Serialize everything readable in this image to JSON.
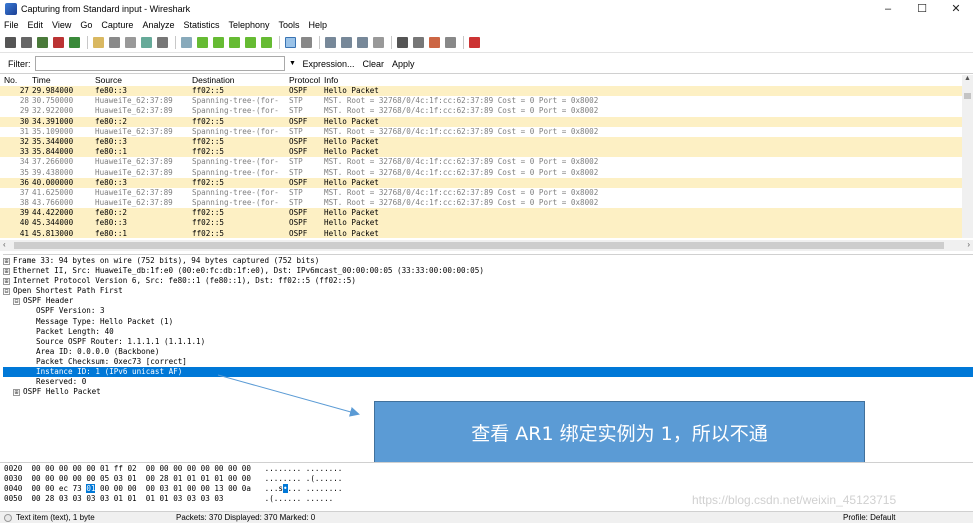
{
  "window": {
    "title": "Capturing from Standard input - Wireshark",
    "minimize": "–",
    "maximize": "☐",
    "close": "✕"
  },
  "menu": [
    "File",
    "Edit",
    "View",
    "Go",
    "Capture",
    "Analyze",
    "Statistics",
    "Telephony",
    "Tools",
    "Help"
  ],
  "filter": {
    "label": "Filter:",
    "value": "",
    "expression": "Expression...",
    "clear": "Clear",
    "apply": "Apply"
  },
  "packet_list": {
    "columns": [
      "No.",
      "Time",
      "Source",
      "Destination",
      "Protocol",
      "Info"
    ],
    "rows": [
      {
        "no": "27",
        "time": "29.984000",
        "src": "fe80::3",
        "dst": "ff02::5",
        "proto": "OSPF",
        "info": "Hello Packet",
        "kind": "ospf"
      },
      {
        "no": "28",
        "time": "30.750000",
        "src": "HuaweiTe_62:37:89",
        "dst": "Spanning-tree-(for-",
        "proto": "STP",
        "info": "MST. Root = 32768/0/4c:1f:cc:62:37:89  Cost = 0  Port = 0x8002",
        "kind": "stp"
      },
      {
        "no": "29",
        "time": "32.922000",
        "src": "HuaweiTe_62:37:89",
        "dst": "Spanning-tree-(for-",
        "proto": "STP",
        "info": "MST. Root = 32768/0/4c:1f:cc:62:37:89  Cost = 0  Port = 0x8002",
        "kind": "stp"
      },
      {
        "no": "30",
        "time": "34.391000",
        "src": "fe80::2",
        "dst": "ff02::5",
        "proto": "OSPF",
        "info": "Hello Packet",
        "kind": "ospf"
      },
      {
        "no": "31",
        "time": "35.109000",
        "src": "HuaweiTe_62:37:89",
        "dst": "Spanning-tree-(for-",
        "proto": "STP",
        "info": "MST. Root = 32768/0/4c:1f:cc:62:37:89  Cost = 0  Port = 0x8002",
        "kind": "stp"
      },
      {
        "no": "32",
        "time": "35.344000",
        "src": "fe80::3",
        "dst": "ff02::5",
        "proto": "OSPF",
        "info": "Hello Packet",
        "kind": "ospf"
      },
      {
        "no": "33",
        "time": "35.844000",
        "src": "fe80::1",
        "dst": "ff02::5",
        "proto": "OSPF",
        "info": "Hello Packet",
        "kind": "ospf"
      },
      {
        "no": "34",
        "time": "37.266000",
        "src": "HuaweiTe_62:37:89",
        "dst": "Spanning-tree-(for-",
        "proto": "STP",
        "info": "MST. Root = 32768/0/4c:1f:cc:62:37:89  Cost = 0  Port = 0x8002",
        "kind": "stp"
      },
      {
        "no": "35",
        "time": "39.438000",
        "src": "HuaweiTe_62:37:89",
        "dst": "Spanning-tree-(for-",
        "proto": "STP",
        "info": "MST. Root = 32768/0/4c:1f:cc:62:37:89  Cost = 0  Port = 0x8002",
        "kind": "stp"
      },
      {
        "no": "36",
        "time": "40.000000",
        "src": "fe80::3",
        "dst": "ff02::5",
        "proto": "OSPF",
        "info": "Hello Packet",
        "kind": "ospf"
      },
      {
        "no": "37",
        "time": "41.625000",
        "src": "HuaweiTe_62:37:89",
        "dst": "Spanning-tree-(for-",
        "proto": "STP",
        "info": "MST. Root = 32768/0/4c:1f:cc:62:37:89  Cost = 0  Port = 0x8002",
        "kind": "stp"
      },
      {
        "no": "38",
        "time": "43.766000",
        "src": "HuaweiTe_62:37:89",
        "dst": "Spanning-tree-(for-",
        "proto": "STP",
        "info": "MST. Root = 32768/0/4c:1f:cc:62:37:89  Cost = 0  Port = 0x8002",
        "kind": "stp"
      },
      {
        "no": "39",
        "time": "44.422000",
        "src": "fe80::2",
        "dst": "ff02::5",
        "proto": "OSPF",
        "info": "Hello Packet",
        "kind": "ospf"
      },
      {
        "no": "40",
        "time": "45.344000",
        "src": "fe80::3",
        "dst": "ff02::5",
        "proto": "OSPF",
        "info": "Hello Packet",
        "kind": "ospf"
      },
      {
        "no": "41",
        "time": "45.813000",
        "src": "fe80::1",
        "dst": "ff02::5",
        "proto": "OSPF",
        "info": "Hello Packet",
        "kind": "ospf"
      }
    ]
  },
  "details": [
    {
      "indent": 0,
      "exp": "⊞",
      "text": "Frame 33: 94 bytes on wire (752 bits), 94 bytes captured (752 bits)"
    },
    {
      "indent": 0,
      "exp": "⊞",
      "text": "Ethernet II, Src: HuaweiTe_db:1f:e0 (00:e0:fc:db:1f:e0), Dst: IPv6mcast_00:00:00:05 (33:33:00:00:00:05)"
    },
    {
      "indent": 0,
      "exp": "⊞",
      "text": "Internet Protocol Version 6, Src: fe80::1 (fe80::1), Dst: ff02::5 (ff02::5)"
    },
    {
      "indent": 0,
      "exp": "⊟",
      "text": "Open Shortest Path First"
    },
    {
      "indent": 1,
      "exp": "⊟",
      "text": "OSPF Header"
    },
    {
      "indent": 2,
      "exp": "",
      "text": "OSPF Version: 3"
    },
    {
      "indent": 2,
      "exp": "",
      "text": "Message Type: Hello Packet (1)"
    },
    {
      "indent": 2,
      "exp": "",
      "text": "Packet Length: 40"
    },
    {
      "indent": 2,
      "exp": "",
      "text": "Source OSPF Router: 1.1.1.1 (1.1.1.1)"
    },
    {
      "indent": 2,
      "exp": "",
      "text": "Area ID: 0.0.0.0 (Backbone)"
    },
    {
      "indent": 2,
      "exp": "",
      "text": "Packet Checksum: 0xec73 [correct]"
    },
    {
      "indent": 2,
      "exp": "",
      "text": "Instance ID: 1 (IPv6 unicast AF)",
      "selected": true
    },
    {
      "indent": 2,
      "exp": "",
      "text": "Reserved: 0"
    },
    {
      "indent": 1,
      "exp": "⊞",
      "text": "OSPF Hello Packet"
    }
  ],
  "bytes": [
    {
      "offset": "0020",
      "hex1": "00 00 00 00 00 01 ff 02",
      "hex2": "00 00 00 00 00 00 00 00",
      "ascii": "........ ........"
    },
    {
      "offset": "0030",
      "hex1": "00 00 00 00 00 05 03 01",
      "hex2": "00 28 01 01 01 01 00 00",
      "ascii": "........ .(......"
    },
    {
      "offset": "0040",
      "hex1a": "00 00 ec 73 ",
      "hexhl": "01",
      "hex1b": " 00 00 00",
      "hex2": "00 03 01 00 00 13 00 0a",
      "asciia": "...s",
      "asciihl": "•",
      "asciib": "... ........"
    },
    {
      "offset": "0050",
      "hex1": "00 28 03 03 03 03 01 01",
      "hex2": "01 01 03 03 03 03",
      "ascii": ".(...... ......"
    }
  ],
  "callout": {
    "text": "查看 AR1 绑定实例为 1，所以不通"
  },
  "status": {
    "left": "Text item (text), 1 byte",
    "packets": "Packets: 370 Displayed: 370 Marked: 0",
    "profile": "Profile: Default"
  },
  "watermark": "https://blog.csdn.net/weixin_45123715"
}
